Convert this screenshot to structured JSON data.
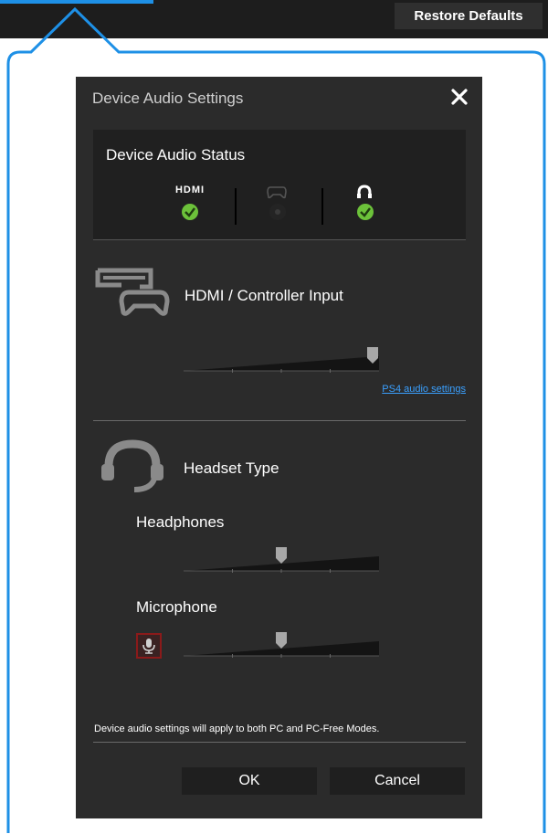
{
  "toolbar": {
    "restore_defaults_label": "Restore Defaults"
  },
  "dialog": {
    "title": "Device Audio Settings",
    "close_icon": "close-icon",
    "status": {
      "title": "Device Audio Status",
      "hdmi_label": "HDMI",
      "items": [
        {
          "name": "hdmi",
          "connected": true
        },
        {
          "name": "controller",
          "connected": false
        },
        {
          "name": "headset",
          "connected": true
        }
      ]
    },
    "hdmi_section": {
      "label": "HDMI / Controller Input",
      "level": 1.0,
      "link_label": "PS4 audio settings"
    },
    "headset_section": {
      "label": "Headset Type",
      "headphones_label": "Headphones",
      "headphones_level": 0.5,
      "microphone_label": "Microphone",
      "microphone_level": 0.5
    },
    "footnote": "Device audio settings will apply to both PC and PC-Free Modes.",
    "ok_label": "OK",
    "cancel_label": "Cancel"
  },
  "colors": {
    "accent": "#1e90e6",
    "check": "#6cc23a",
    "link": "#3aa0ff"
  }
}
